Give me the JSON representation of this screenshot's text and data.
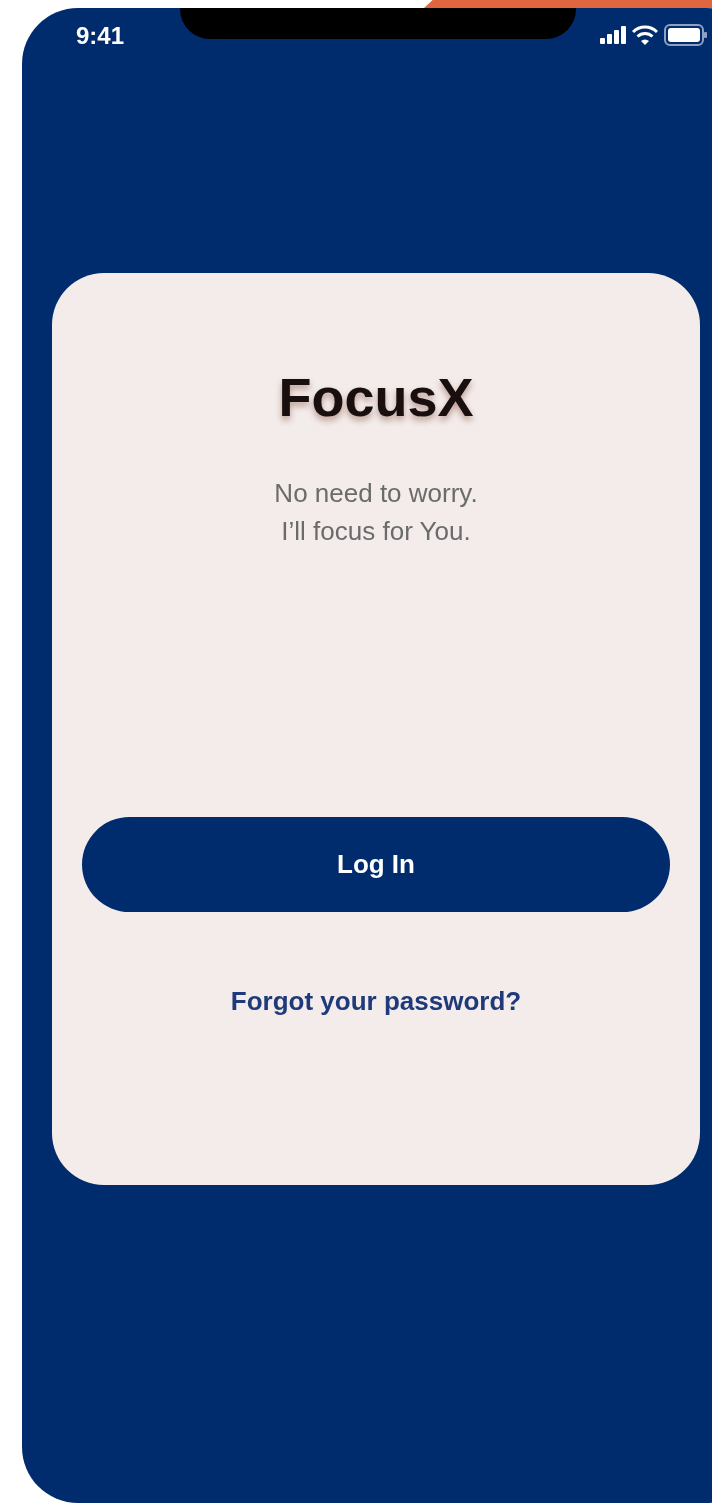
{
  "status_bar": {
    "time": "9:41"
  },
  "card": {
    "title": "FocusX",
    "tagline": [
      "No need to worry.",
      "I’ll focus for You."
    ],
    "login_button": "Log In",
    "forgot_link": "Forgot your password?"
  }
}
